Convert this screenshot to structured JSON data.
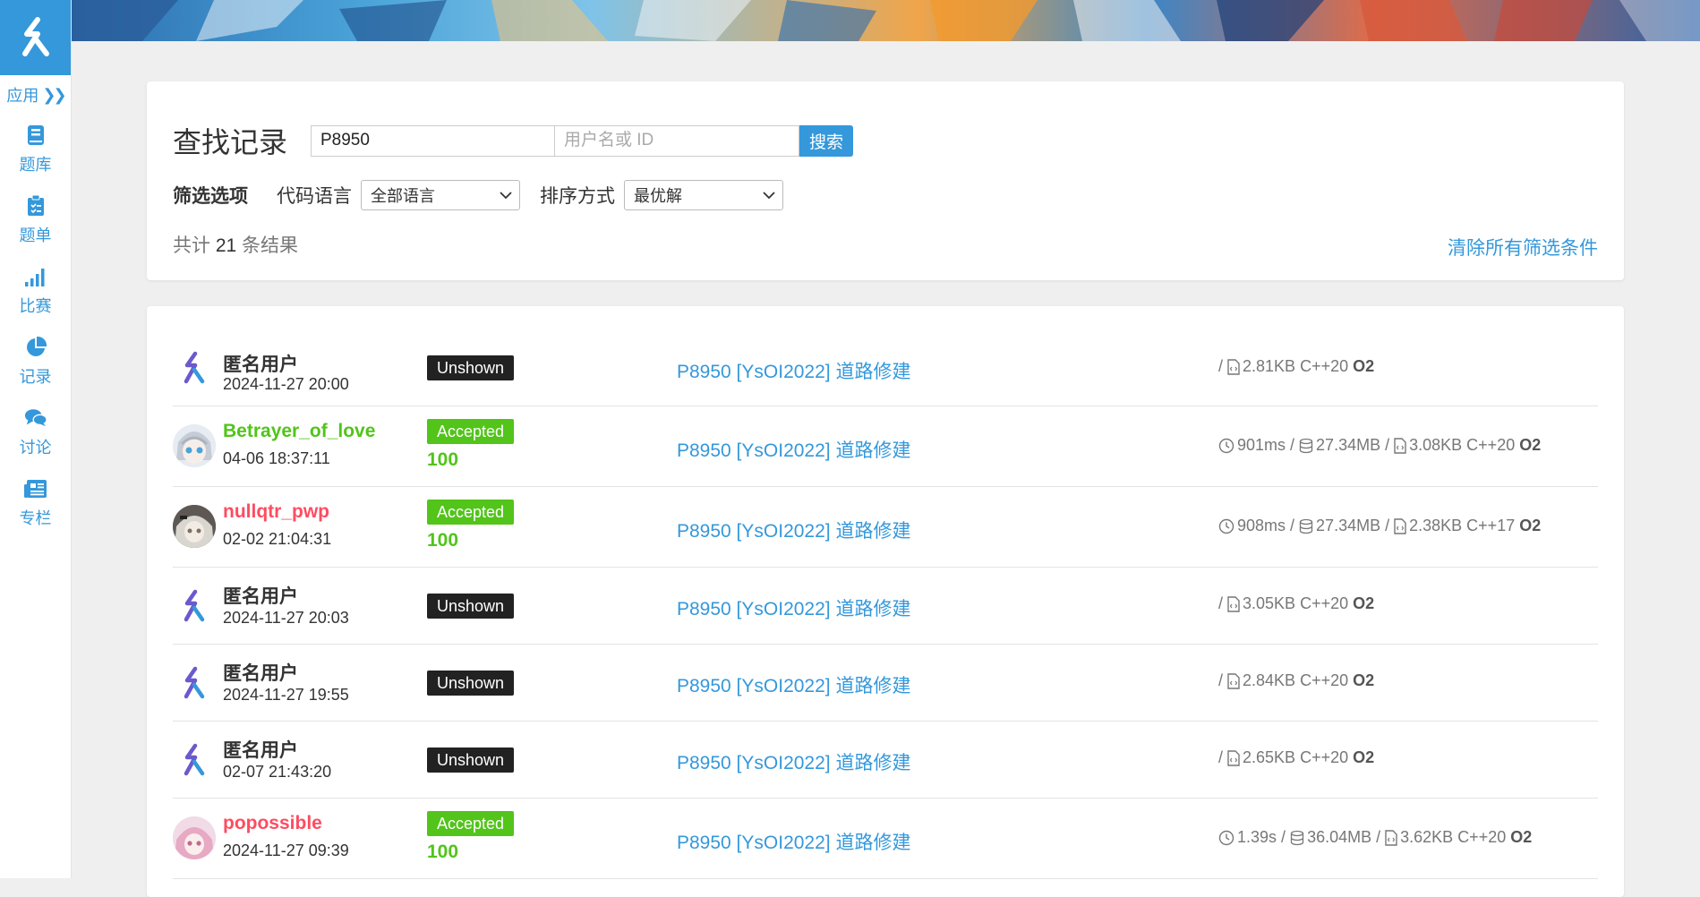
{
  "sidebar": {
    "logo_icon": "luogu-logo-icon",
    "apps_label": "应用",
    "items": [
      {
        "label": "题库",
        "icon": "book-icon"
      },
      {
        "label": "题单",
        "icon": "clipboard-icon"
      },
      {
        "label": "比赛",
        "icon": "signal-bars-icon"
      },
      {
        "label": "记录",
        "icon": "pie-chart-icon"
      },
      {
        "label": "讨论",
        "icon": "comments-icon"
      },
      {
        "label": "专栏",
        "icon": "newspaper-icon"
      }
    ]
  },
  "search": {
    "title": "查找记录",
    "problem_value": "P8950",
    "user_placeholder": "用户名或 ID",
    "button": "搜索"
  },
  "filters": {
    "title": "筛选选项",
    "language_label": "代码语言",
    "language_value": "全部语言",
    "order_label": "排序方式",
    "order_value": "最优解"
  },
  "results": {
    "prefix": "共计",
    "count": "21",
    "suffix": "条结果",
    "clear": "清除所有筛选条件"
  },
  "colors": {
    "accent": "#3498db",
    "accepted": "#52c41a",
    "red_user": "#fe4c61",
    "unshown": "#222222"
  },
  "records": [
    {
      "user": "匿名用户",
      "time": "2024-11-27 20:00",
      "status": "Unshown",
      "problem": "P8950 [YsOI2022] 道路修建",
      "size": "2.81KB",
      "lang": "C++20",
      "opt": "O2"
    },
    {
      "user": "Betrayer_of_love",
      "time": "04-06 18:37:11",
      "status": "Accepted",
      "score": "100",
      "problem": "P8950 [YsOI2022] 道路修建",
      "runtime": "901ms",
      "memory": "27.34MB",
      "size": "3.08KB",
      "lang": "C++20",
      "opt": "O2"
    },
    {
      "user": "nullqtr_pwp",
      "time": "02-02 21:04:31",
      "status": "Accepted",
      "score": "100",
      "problem": "P8950 [YsOI2022] 道路修建",
      "runtime": "908ms",
      "memory": "27.34MB",
      "size": "2.38KB",
      "lang": "C++17",
      "opt": "O2"
    },
    {
      "user": "匿名用户",
      "time": "2024-11-27 20:03",
      "status": "Unshown",
      "problem": "P8950 [YsOI2022] 道路修建",
      "size": "3.05KB",
      "lang": "C++20",
      "opt": "O2"
    },
    {
      "user": "匿名用户",
      "time": "2024-11-27 19:55",
      "status": "Unshown",
      "problem": "P8950 [YsOI2022] 道路修建",
      "size": "2.84KB",
      "lang": "C++20",
      "opt": "O2"
    },
    {
      "user": "匿名用户",
      "time": "02-07 21:43:20",
      "status": "Unshown",
      "problem": "P8950 [YsOI2022] 道路修建",
      "size": "2.65KB",
      "lang": "C++20",
      "opt": "O2"
    },
    {
      "user": "popossible",
      "time": "2024-11-27 09:39",
      "status": "Accepted",
      "score": "100",
      "problem": "P8950 [YsOI2022] 道路修建",
      "runtime": "1.39s",
      "memory": "36.04MB",
      "size": "3.62KB",
      "lang": "C++20",
      "opt": "O2"
    }
  ]
}
